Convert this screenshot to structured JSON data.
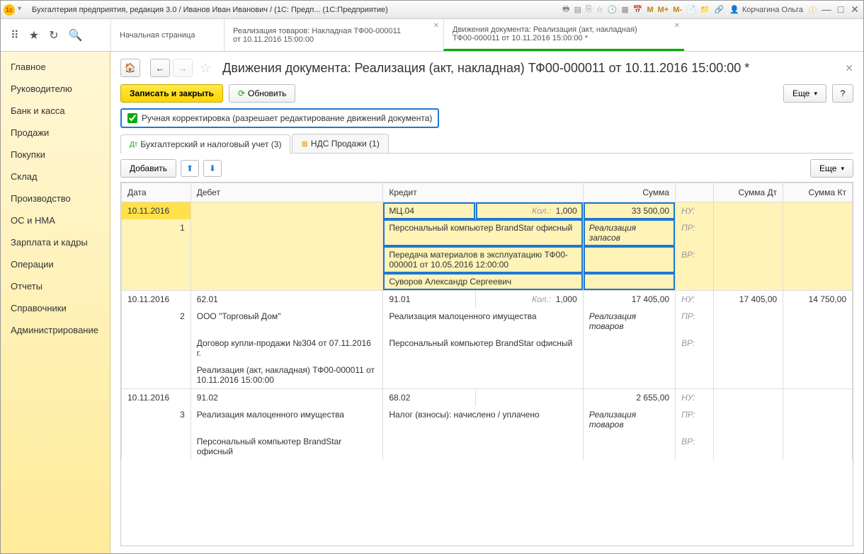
{
  "titlebar": {
    "title": "Бухгалтерия предприятия, редакция 3.0 / Иванов Иван Иванович / (1С: Предп... (1С:Предприятие)",
    "user": "Корчагина Ольга",
    "m_labels": [
      "M",
      "M+",
      "M-"
    ]
  },
  "tabs": {
    "home": "Начальная страница",
    "tab1_l1": "Реализация товаров: Накладная ТФ00-000011",
    "tab1_l2": "от 10.11.2016 15:00:00",
    "tab2_l1": "Движения документа: Реализация (акт, накладная)",
    "tab2_l2": "ТФ00-000011 от 10.11.2016 15:00:00 *"
  },
  "sidebar": [
    "Главное",
    "Руководителю",
    "Банк и касса",
    "Продажи",
    "Покупки",
    "Склад",
    "Производство",
    "ОС и НМА",
    "Зарплата и кадры",
    "Операции",
    "Отчеты",
    "Справочники",
    "Администрирование"
  ],
  "page": {
    "title": "Движения документа: Реализация (акт, накладная) ТФ00-000011 от 10.11.2016 15:00:00 *",
    "save_close": "Записать и закрыть",
    "refresh": "Обновить",
    "more": "Еще",
    "help": "?",
    "checkbox": "Ручная корректировка (разрешает редактирование движений документа)",
    "subtab1": "Бухгалтерский и налоговый учет (3)",
    "subtab2": "НДС Продажи (1)",
    "add": "Добавить"
  },
  "cols": {
    "date": "Дата",
    "debit": "Дебет",
    "credit": "Кредит",
    "sum": "Сумма",
    "sumdt": "Сумма Дт",
    "sumkt": "Сумма Кт"
  },
  "labels": {
    "qty": "Кол.:",
    "nu": "НУ:",
    "pr": "ПР:",
    "vr": "ВР:"
  },
  "rows": [
    {
      "hl": true,
      "n": "1",
      "date": "10.11.2016",
      "credit_acc": "МЦ.04",
      "qty": "1,000",
      "credit_lines": [
        "Персональный компьютер BrandStar офисный",
        "Передача материалов в эксплуатацию ТФ00-000001 от 10.05.2016 12:00:00",
        "Суворов Александр Сергеевич"
      ],
      "sum": "33 500,00",
      "sum_note": "Реализация запасов"
    },
    {
      "n": "2",
      "date": "10.11.2016",
      "debit_acc": "62.01",
      "debit_lines": [
        "ООО \"Торговый Дом\"",
        "Договор купли-продажи №304 от 07.11.2016 г.",
        "Реализация (акт, накладная) ТФ00-000011 от 10.11.2016 15:00:00"
      ],
      "credit_acc": "91.01",
      "qty": "1,000",
      "credit_lines": [
        "Реализация малоценного имущества",
        "Персональный компьютер BrandStar офисный"
      ],
      "sum": "17 405,00",
      "sum_note": "Реализация товаров",
      "sumdt": "17 405,00",
      "sumkt": "14 750,00"
    },
    {
      "n": "3",
      "date": "10.11.2016",
      "debit_acc": "91.02",
      "debit_lines": [
        "Реализация малоценного имущества",
        "Персональный компьютер BrandStar офисный"
      ],
      "credit_acc": "68.02",
      "credit_lines": [
        "Налог (взносы): начислено / уплачено"
      ],
      "sum": "2 655,00",
      "sum_note": "Реализация товаров"
    }
  ]
}
